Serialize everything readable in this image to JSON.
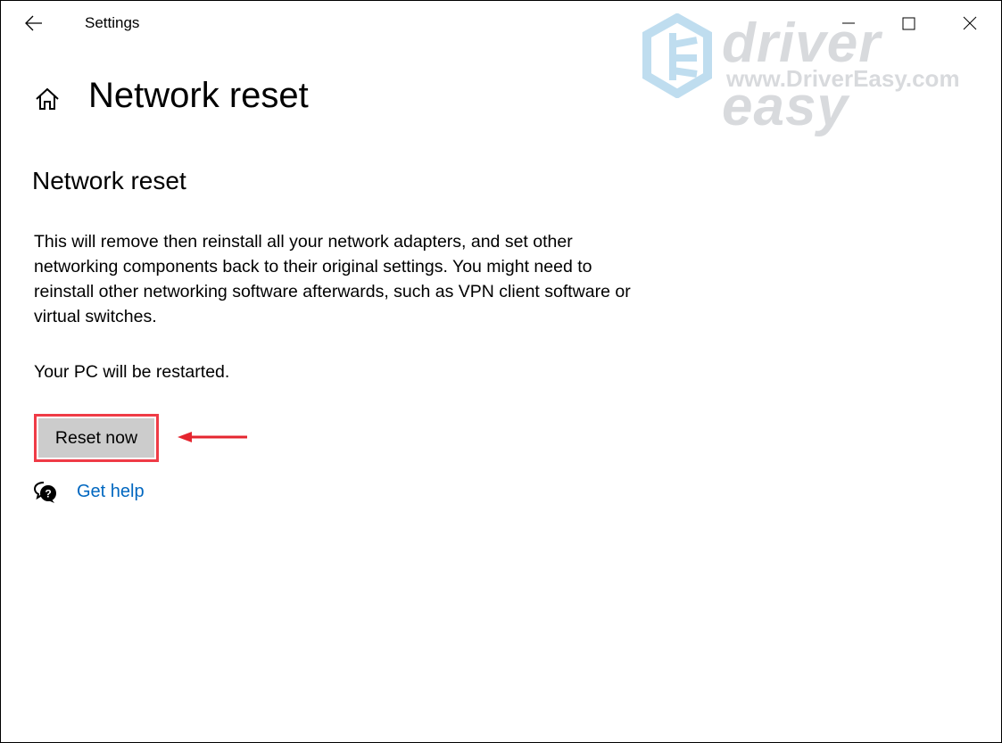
{
  "titlebar": {
    "app_title": "Settings",
    "back_icon": "arrow-left-icon",
    "minimize_icon": "minimize-icon",
    "maximize_icon": "maximize-icon",
    "close_icon": "close-icon"
  },
  "watermark": {
    "brand": "driver easy",
    "url": "www.DriverEasy.com"
  },
  "header": {
    "home_icon": "home-icon",
    "title": "Network reset"
  },
  "main": {
    "section_title": "Network reset",
    "description": "This will remove then reinstall all your network adapters, and set other networking components back to their original settings. You might need to reinstall other networking software afterwards, such as VPN client software or virtual switches.",
    "restart_note": "Your PC will be restarted.",
    "reset_button_label": "Reset now",
    "annotation_color": "#ef3b46",
    "help_icon": "help-chat-icon",
    "help_link": "Get help",
    "link_color": "#0067c0"
  }
}
